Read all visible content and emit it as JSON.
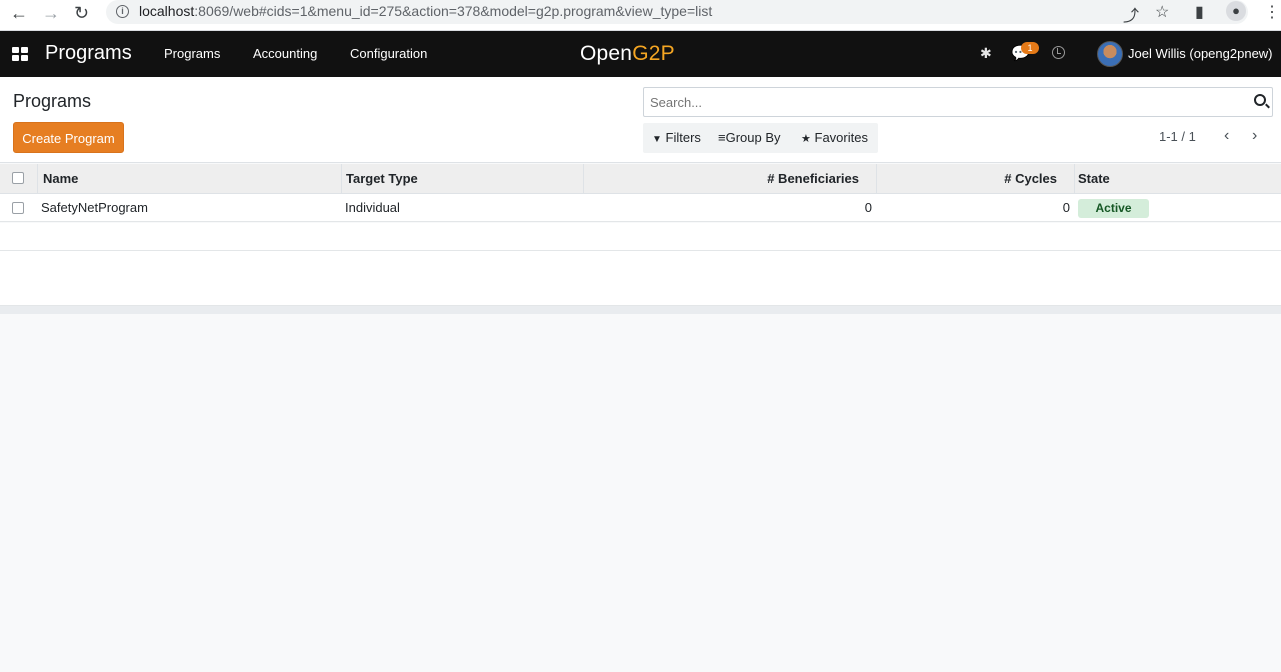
{
  "browser": {
    "url_host": "localhost",
    "url_rest": ":8069/web#cids=1&menu_id=275&action=378&model=g2p.program&view_type=list"
  },
  "topnav": {
    "app_title": "Programs",
    "menu": [
      "Programs",
      "Accounting",
      "Configuration"
    ],
    "logo_open": "Open",
    "logo_g2p": "G2P",
    "chat_badge": "1",
    "user_name": "Joel Willis (openg2pnew)"
  },
  "control": {
    "breadcrumb": "Programs",
    "create_label": "Create Program",
    "search_placeholder": "Search...",
    "filters_label": "Filters",
    "groupby_label": "Group By",
    "favorites_label": "Favorites",
    "pager": "1-1 / 1"
  },
  "table": {
    "columns": [
      "Name",
      "Target Type",
      "# Beneficiaries",
      "# Cycles",
      "State"
    ],
    "rows": [
      {
        "name": "SafetyNetProgram",
        "target_type": "Individual",
        "beneficiaries": "0",
        "cycles": "0",
        "state": "Active"
      }
    ]
  },
  "colors": {
    "primary": "#e67e22",
    "navbar": "#111111",
    "active_badge_bg": "#d4edda",
    "active_badge_fg": "#155724"
  }
}
